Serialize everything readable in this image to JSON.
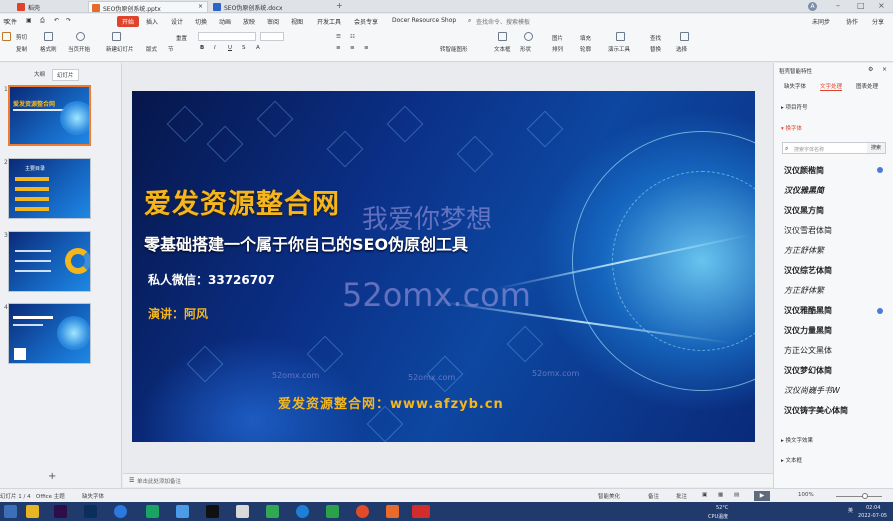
{
  "tabs": [
    {
      "label": "稻壳"
    },
    {
      "label": "SEO伪原创系统.pptx"
    },
    {
      "label": "SEO伪原创系统.docx"
    }
  ],
  "tabbar": {
    "new_tab": "+",
    "user": "A"
  },
  "menu": {
    "file": "文件",
    "items": [
      "开始",
      "插入",
      "设计",
      "切换",
      "动画",
      "放映",
      "审阅",
      "视图",
      "开发工具",
      "会员专享",
      "Docer Resource Shop"
    ],
    "search_placeholder": "查找命令、搜索模板",
    "right": [
      "未同步",
      "协作",
      "分享"
    ]
  },
  "ribbon": {
    "cut": "剪切",
    "copy": "复制",
    "format_painter": "格式刷",
    "play_from_current": "当页开始",
    "new_slide": "新建幻灯片",
    "layout": "版式",
    "section": "节",
    "reset": "重置",
    "text_box": "文本框",
    "shape": "形状",
    "arrange": "排列",
    "picture": "图片",
    "fill": "填充",
    "outline": "轮廓",
    "convert_smartart": "转智能图形",
    "presentation_tools": "演示工具",
    "find": "查找",
    "replace": "替换",
    "select": "选择"
  },
  "left_panel": {
    "tabs": [
      "大纲",
      "幻灯片"
    ],
    "slides": [
      {
        "num": "1",
        "title": "爱发资源整合网"
      },
      {
        "num": "2",
        "title": "主要目录"
      },
      {
        "num": "3",
        "title": ""
      },
      {
        "num": "4",
        "title": ""
      }
    ],
    "add": "+"
  },
  "slide": {
    "title": "爱发资源整合网",
    "subtitle": "零基础搭建一个属于你自己的SEO伪原创工具",
    "wechat": "私人微信：33726707",
    "speaker": "演讲：阿风",
    "footer": "爱发资源整合网：www.afzyb.cn",
    "watermark_cn": "我爱你梦想",
    "watermark_big": "52omx.com",
    "watermark_small": "52omx.com"
  },
  "notes": {
    "placeholder": "单击此处添加备注"
  },
  "right_panel": {
    "header": "稻壳智能特性",
    "tabs": [
      "缺失字体",
      "文字处理",
      "图表处理"
    ],
    "section_bullets": "项目符号",
    "section_fonts": "换字体",
    "search_placeholder": "搜索字体名称",
    "search_button": "搜索",
    "fonts": [
      "汉仪颜楷简",
      "汉仪雅黑简",
      "汉仪黑方简",
      "汉仪雪君体简",
      "方正舒体繁",
      "汉仪综艺体简",
      "方正舒体繁",
      "汉仪雅酷黑简",
      "汉仪力量黑简",
      "方正公文黑体",
      "汉仪梦幻体简",
      "汉仪尚巍手书W",
      "汉仪铸字美心体简"
    ],
    "section_effects": "换文字效果",
    "section_textbox": "文本框"
  },
  "statusbar": {
    "slide_count": "幻灯片 1 / 4",
    "theme": "Office 主题",
    "missing_font": "缺失字体",
    "smart_beautify": "智能美化",
    "notes": "备注",
    "comment": "批注",
    "zoom": "100%"
  },
  "taskbar": {
    "weather": "52°C",
    "cpu": "CPU温度",
    "time": "02:04",
    "date": "2022-07-05",
    "ime": "英"
  },
  "colors": {
    "accent": "#e0432c",
    "slide_gold": "#f5b61d",
    "thumb_selected": "#f07a2e"
  }
}
